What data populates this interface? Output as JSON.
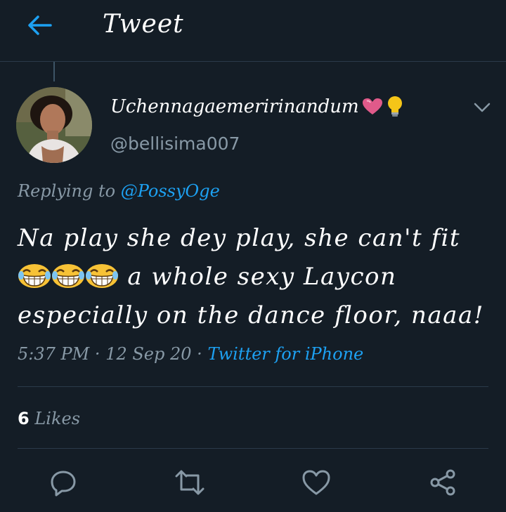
{
  "header": {
    "title": "Tweet",
    "back_icon": "arrow-left-icon",
    "accent": "#1da1f2"
  },
  "tweet": {
    "author_name": "Uchennagaemeririnandum",
    "author_emojis": [
      "heart-icon",
      "lightbulb-icon"
    ],
    "author_handle": "@bellisima007",
    "replying_prefix": "Replying to",
    "replying_to": "@PossyOge",
    "text_line1": "Na play she dey play, she can't fit",
    "text_line2_emojis": [
      "grinning-sweat-emoji",
      "grinning-sweat-emoji",
      "grinning-sweat-emoji"
    ],
    "text_line2": "a whole sexy Laycon",
    "text_line3": "especially on the dance floor, naaa!",
    "time": "5:37 PM",
    "date": "12 Sep 20",
    "separator": "·",
    "source": "Twitter for iPhone",
    "likes_count": "6",
    "likes_label": "Likes"
  },
  "actions": [
    "reply-icon",
    "retweet-icon",
    "like-icon",
    "share-icon"
  ],
  "colors": {
    "background": "#141d26",
    "secondary_text": "#8899a6",
    "link": "#1da1f2",
    "divider": "#2b3a4a"
  }
}
